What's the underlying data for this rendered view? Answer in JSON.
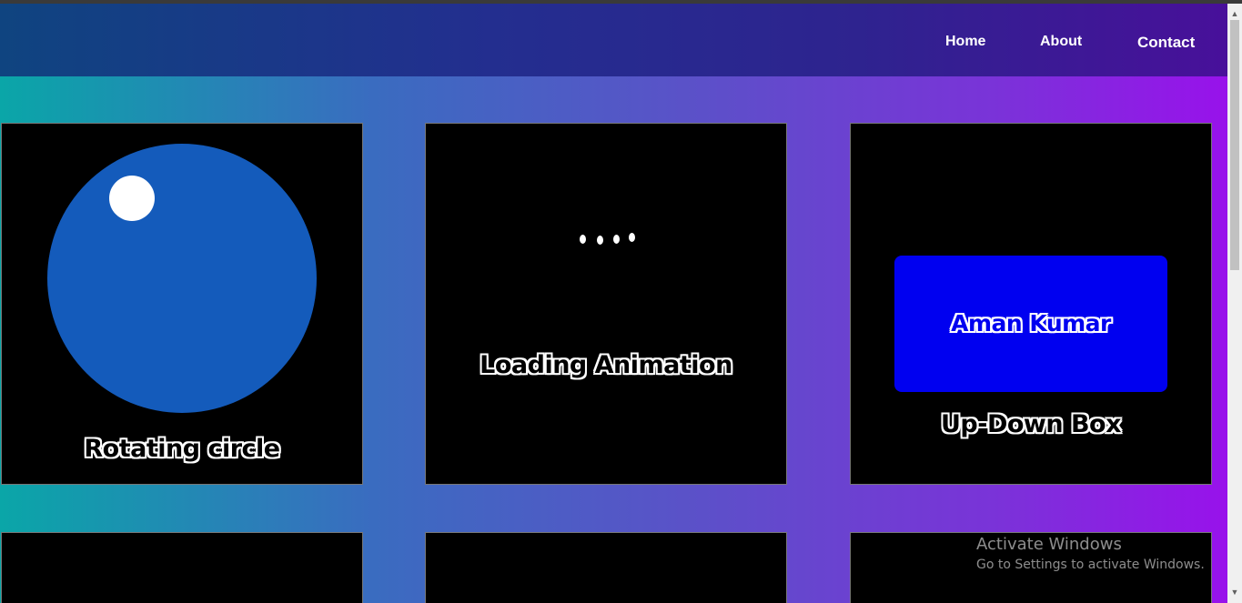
{
  "nav": {
    "home": "Home",
    "about": "About",
    "contact": "Contact"
  },
  "cards": [
    {
      "label": "Rotating circle"
    },
    {
      "label": "Loading Animation"
    },
    {
      "label": "Up-Down Box",
      "box_text": "Aman Kumar"
    }
  ],
  "watermark": {
    "line1": "Activate Windows",
    "line2": "Go to Settings to activate Windows."
  },
  "colors": {
    "circle": "#145bbb",
    "box": "#0000f0",
    "card_bg": "#000000"
  }
}
